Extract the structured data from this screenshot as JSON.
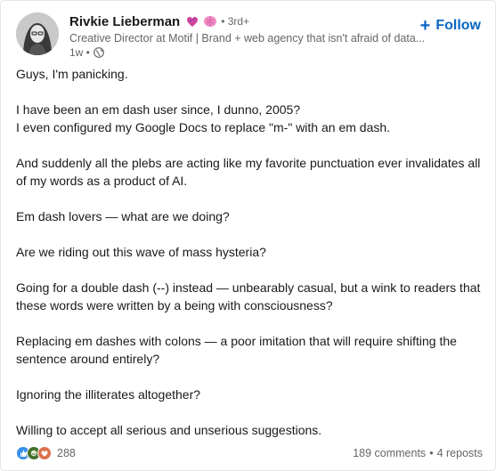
{
  "author": {
    "name": "Rivkie Lieberman",
    "degree": "• 3rd+",
    "headline": "Creative Director at Motif | Brand + web agency that isn't afraid of data...",
    "time": "1w •"
  },
  "follow_label": "Follow",
  "body": [
    "Guys, I'm panicking.",
    "I have been an em dash user since, I dunno, 2005?",
    "I even configured my Google Docs to replace \"m-\" with an em dash.",
    "And suddenly all the plebs are acting like my favorite punctuation ever invalidates all of my words as a product of AI.",
    "Em dash lovers — what are we doing?",
    "Are we riding out this wave of mass hysteria?",
    "Going for a double dash (--) instead — unbearably casual, but a wink to readers that these words were written by a being with consciousness?",
    "Replacing em dashes with colons — a poor imitation that will require shifting the sentence around entirely?",
    "Ignoring the illiterates altogether?",
    "Willing to accept all serious and unserious suggestions."
  ],
  "footer": {
    "reaction_count": "288",
    "comments": "189 comments",
    "separator": "•",
    "reposts": "4 reposts"
  },
  "colors": {
    "accent": "#0a66c2",
    "like": "#378fe9",
    "celebrate": "#44712e",
    "love": "#df704d",
    "muted": "#666666"
  }
}
